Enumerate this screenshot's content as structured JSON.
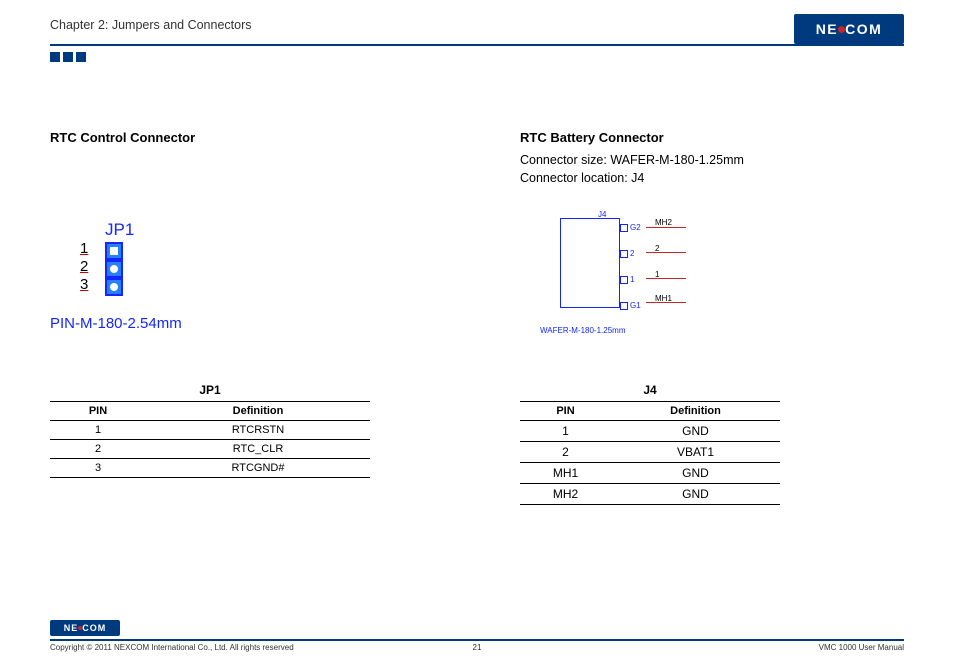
{
  "header": {
    "chapter": "Chapter 2: Jumpers and Connectors",
    "logo_text_left": "NE",
    "logo_text_right": "COM"
  },
  "left": {
    "title": "RTC Control Connector",
    "diagram": {
      "label": "JP1",
      "pins": [
        "1",
        "2",
        "3"
      ],
      "part": "PIN-M-180-2.54mm"
    },
    "table": {
      "caption": "JP1",
      "headers": [
        "PIN",
        "Definition"
      ],
      "rows": [
        [
          "1",
          "RTCRSTN"
        ],
        [
          "2",
          "RTC_CLR"
        ],
        [
          "3",
          "RTCGND#"
        ]
      ]
    }
  },
  "right": {
    "title": "RTC Battery Connector",
    "sub1": "Connector size: WAFER-M-180-1.25mm",
    "sub2": "Connector location: J4",
    "diagram": {
      "label": "J4",
      "pins": {
        "g2": "G2",
        "p2": "2",
        "p1": "1",
        "g1": "G1"
      },
      "rlabels": {
        "mh2": "MH2",
        "r2": "2",
        "r1": "1",
        "mh1": "MH1"
      },
      "part": "WAFER-M-180-1.25mm"
    },
    "table": {
      "caption": "J4",
      "headers": [
        "PIN",
        "Definition"
      ],
      "rows": [
        [
          "1",
          "GND"
        ],
        [
          "2",
          "VBAT1"
        ],
        [
          "MH1",
          "GND"
        ],
        [
          "MH2",
          "GND"
        ]
      ]
    }
  },
  "footer": {
    "copyright": "Copyright © 2011 NEXCOM International Co., Ltd. All rights reserved",
    "page": "21",
    "doc": "VMC 1000 User Manual"
  }
}
